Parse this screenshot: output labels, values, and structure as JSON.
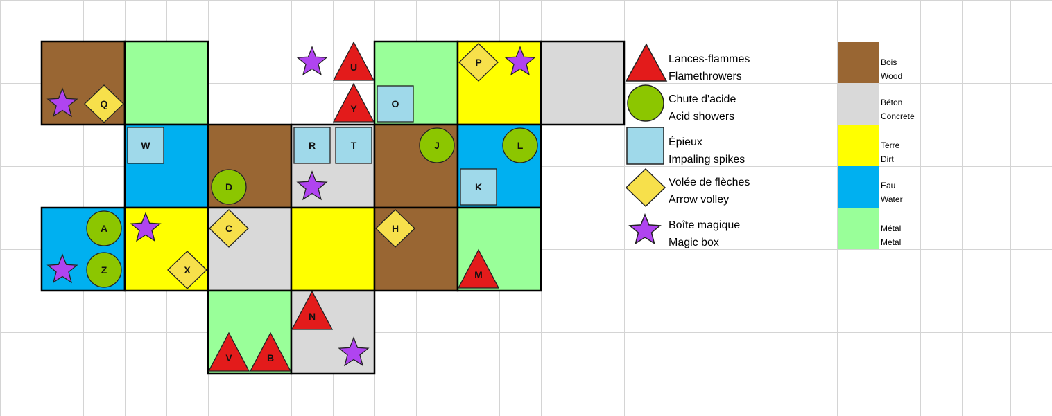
{
  "materials": {
    "wood": {
      "fr": "Bois",
      "en": "Wood",
      "color": "#996633"
    },
    "concrete": {
      "fr": "Béton",
      "en": "Concrete",
      "color": "#d9d9d9"
    },
    "dirt": {
      "fr": "Terre",
      "en": "Dirt",
      "color": "#ffff00"
    },
    "water": {
      "fr": "Eau",
      "en": "Water",
      "color": "#00b0f0"
    },
    "metal": {
      "fr": "Métal",
      "en": "Metal",
      "color": "#99ff99"
    }
  },
  "traps": {
    "flamethrower": {
      "fr": "Lances-flammes",
      "en": "Flamethrowers",
      "shape": "triangle-icon",
      "color": "#e31b1b"
    },
    "acid": {
      "fr": "Chute d'acide",
      "en": "Acid showers",
      "shape": "circle-icon",
      "color": "#8cc600"
    },
    "spikes": {
      "fr": "Épieux",
      "en": "Impaling spikes",
      "shape": "square-icon",
      "color": "#9fd9ea"
    },
    "arrows": {
      "fr": "Volée de flèches",
      "en": "Arrow volley",
      "shape": "diamond-icon",
      "color": "#f7e04b"
    },
    "magic": {
      "fr": "Boîte magique",
      "en": "Magic box",
      "shape": "star-icon",
      "color": "#b044f0"
    }
  },
  "legend_order": [
    "flamethrower",
    "acid",
    "spikes",
    "arrows",
    "magic"
  ],
  "material_order": [
    "wood",
    "concrete",
    "dirt",
    "water",
    "metal"
  ],
  "map": {
    "rooms": [
      {
        "col": 1,
        "row": 1,
        "material": "wood"
      },
      {
        "col": 2,
        "row": 1,
        "material": "metal"
      },
      {
        "col": 5,
        "row": 1,
        "material": "metal"
      },
      {
        "col": 6,
        "row": 1,
        "material": "dirt"
      },
      {
        "col": 7,
        "row": 1,
        "material": "concrete"
      },
      {
        "col": 2,
        "row": 2,
        "material": "water"
      },
      {
        "col": 3,
        "row": 2,
        "material": "wood"
      },
      {
        "col": 4,
        "row": 2,
        "material": "concrete"
      },
      {
        "col": 5,
        "row": 2,
        "material": "wood"
      },
      {
        "col": 6,
        "row": 2,
        "material": "water"
      },
      {
        "col": 1,
        "row": 3,
        "material": "water"
      },
      {
        "col": 2,
        "row": 3,
        "material": "dirt"
      },
      {
        "col": 3,
        "row": 3,
        "material": "concrete"
      },
      {
        "col": 4,
        "row": 3,
        "material": "dirt"
      },
      {
        "col": 5,
        "row": 3,
        "material": "wood"
      },
      {
        "col": 6,
        "row": 3,
        "material": "metal"
      },
      {
        "col": 3,
        "row": 4,
        "material": "metal"
      },
      {
        "col": 4,
        "row": 4,
        "material": "concrete"
      }
    ],
    "markers": [
      {
        "type": "magic",
        "label": "",
        "cell": [
          1,
          2
        ]
      },
      {
        "type": "arrows",
        "label": "Q",
        "cell": [
          2,
          2
        ]
      },
      {
        "type": "magic",
        "label": "",
        "cell": [
          7,
          1
        ]
      },
      {
        "type": "flamethrower",
        "label": "U",
        "cell": [
          8,
          1
        ]
      },
      {
        "type": "flamethrower",
        "label": "Y",
        "cell": [
          8,
          2
        ]
      },
      {
        "type": "spikes",
        "label": "O",
        "cell": [
          9,
          2
        ]
      },
      {
        "type": "arrows",
        "label": "P",
        "cell": [
          11,
          1
        ]
      },
      {
        "type": "magic",
        "label": "",
        "cell": [
          12,
          1
        ]
      },
      {
        "type": "spikes",
        "label": "W",
        "cell": [
          3,
          3
        ]
      },
      {
        "type": "acid",
        "label": "D",
        "cell": [
          5,
          4
        ]
      },
      {
        "type": "spikes",
        "label": "R",
        "cell": [
          7,
          3
        ]
      },
      {
        "type": "spikes",
        "label": "T",
        "cell": [
          8,
          3
        ]
      },
      {
        "type": "magic",
        "label": "",
        "cell": [
          7,
          4
        ]
      },
      {
        "type": "acid",
        "label": "J",
        "cell": [
          10,
          3
        ]
      },
      {
        "type": "acid",
        "label": "L",
        "cell": [
          12,
          3
        ]
      },
      {
        "type": "spikes",
        "label": "K",
        "cell": [
          11,
          4
        ]
      },
      {
        "type": "acid",
        "label": "A",
        "cell": [
          2,
          5
        ]
      },
      {
        "type": "acid",
        "label": "Z",
        "cell": [
          2,
          6
        ]
      },
      {
        "type": "magic",
        "label": "",
        "cell": [
          1,
          6
        ]
      },
      {
        "type": "magic",
        "label": "",
        "cell": [
          3,
          5
        ]
      },
      {
        "type": "arrows",
        "label": "X",
        "cell": [
          4,
          6
        ]
      },
      {
        "type": "arrows",
        "label": "C",
        "cell": [
          5,
          5
        ]
      },
      {
        "type": "arrows",
        "label": "H",
        "cell": [
          9,
          5
        ]
      },
      {
        "type": "flamethrower",
        "label": "M",
        "cell": [
          11,
          6
        ]
      },
      {
        "type": "flamethrower",
        "label": "N",
        "cell": [
          7,
          7
        ]
      },
      {
        "type": "flamethrower",
        "label": "V",
        "cell": [
          5,
          8
        ]
      },
      {
        "type": "flamethrower",
        "label": "B",
        "cell": [
          6,
          8
        ]
      },
      {
        "type": "magic",
        "label": "",
        "cell": [
          8,
          8
        ]
      }
    ]
  }
}
